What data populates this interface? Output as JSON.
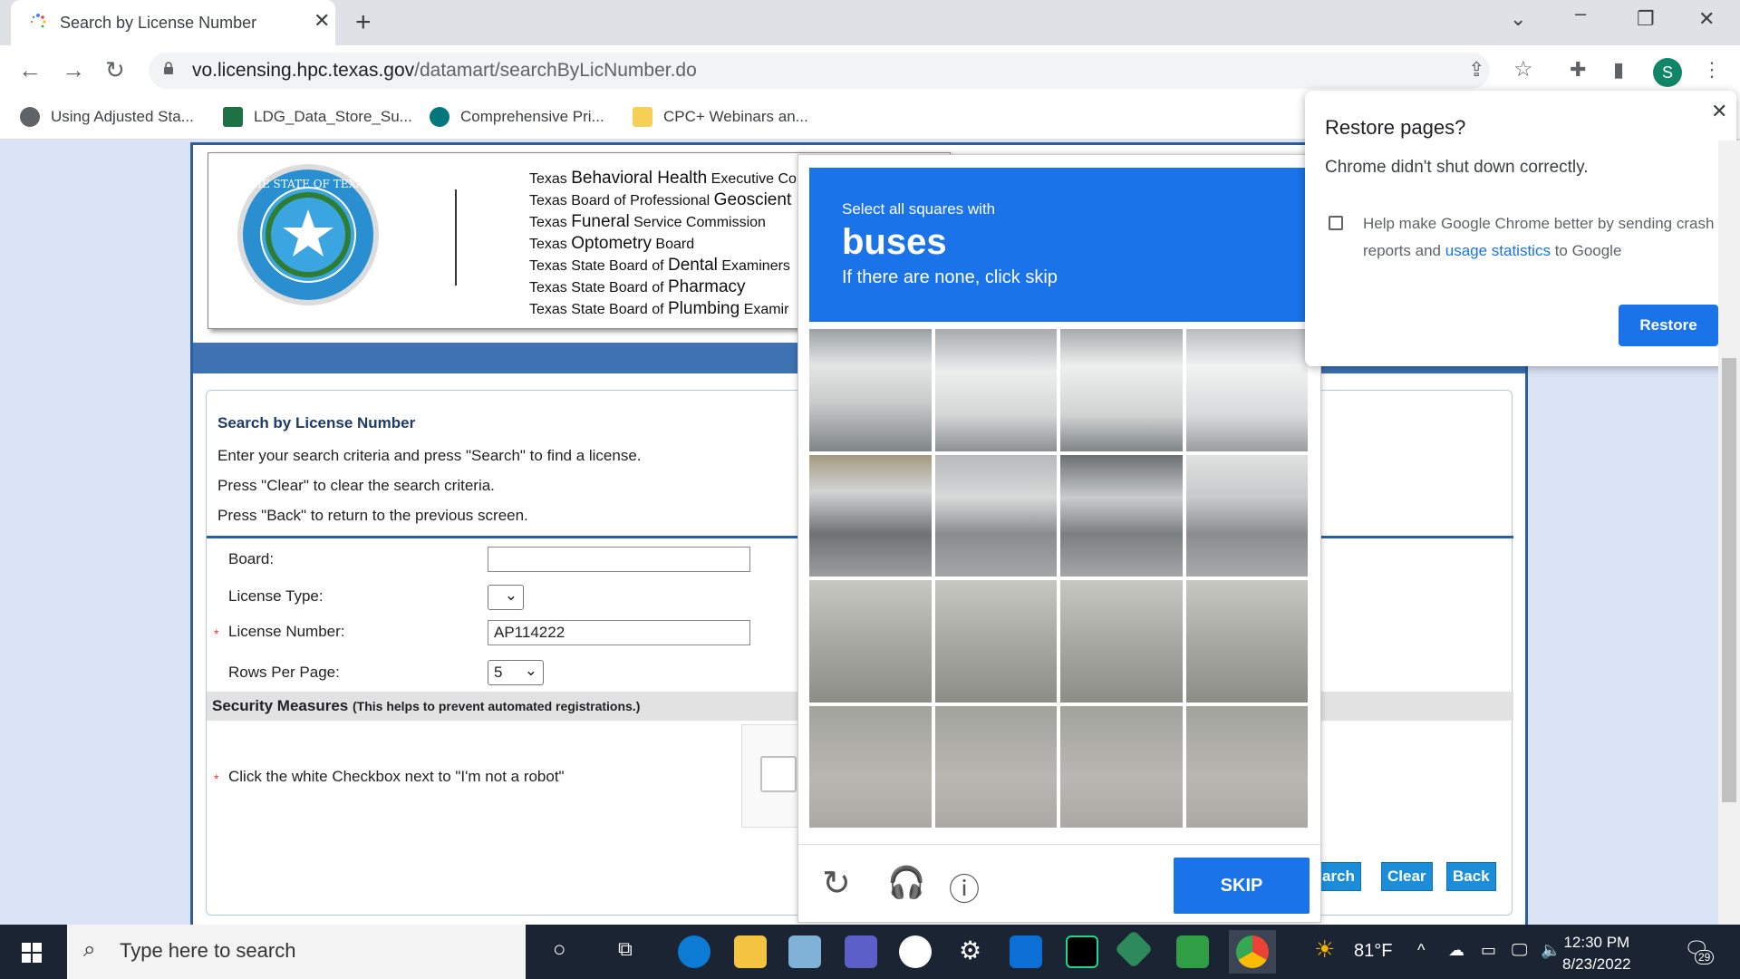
{
  "browser": {
    "tab_title": "Search by License Number",
    "tab_close": "✕",
    "new_tab": "+",
    "url_domain": "vo.licensing.hpc.texas.gov",
    "url_path": "/datamart/searchByLicNumber.do",
    "avatar_letter": "S",
    "bookmarks": [
      "Using Adjusted Sta...",
      "LDG_Data_Store_Su...",
      "Comprehensive Pri...",
      "CPC+ Webinars an..."
    ]
  },
  "header": {
    "boards": [
      {
        "pre": "Texas ",
        "big": "Behavioral Health",
        "post": " Executive Co"
      },
      {
        "pre": "Texas Board of Professional ",
        "big": "Geoscient",
        "post": ""
      },
      {
        "pre": "Texas ",
        "big": "Funeral",
        "post": " Service Commission"
      },
      {
        "pre": "Texas ",
        "big": "Optometry",
        "post": " Board"
      },
      {
        "pre": "Texas State Board of ",
        "big": "Dental",
        "post": " Examiners"
      },
      {
        "pre": "Texas State Board of ",
        "big": "Pharmacy",
        "post": ""
      },
      {
        "pre": "Texas State Board of ",
        "big": "Plumbing",
        "post": " Examir"
      }
    ],
    "seal_text": "THE STATE OF TEXAS"
  },
  "form": {
    "title": "Search by License Number",
    "line1": "Enter your search criteria and press \"Search\" to find a license.",
    "line2": "Press \"Clear\" to clear the search criteria.",
    "line3": "Press \"Back\" to return to the previous screen.",
    "board_label": "Board:",
    "board_value": "",
    "license_type_label": "License Type:",
    "license_type_value": "",
    "license_number_label": "License Number:",
    "license_number_value": "AP114222",
    "rows_label": "Rows Per Page:",
    "rows_value": "5",
    "required_mark": "*",
    "security_title": "Security Measures",
    "security_sub": "(This helps to prevent automated registrations.)",
    "robot_instruction": "Click the white Checkbox next to \"I'm not a robot\"",
    "search_button": "arch",
    "clear_button": "Clear",
    "back_button": "Back"
  },
  "captcha": {
    "line1": "Select all squares with",
    "keyword": "buses",
    "line3": "If there are none, click skip",
    "skip_label": "SKIP",
    "tiles": 16
  },
  "restore_dialog": {
    "heading": "Restore pages?",
    "message": "Chrome didn't shut down correctly.",
    "checkbox_text_1": "Help make Google Chrome better by sending crash reports and ",
    "checkbox_link": "usage statistics",
    "checkbox_text_2": " to Google",
    "button": "Restore",
    "close": "✕"
  },
  "taskbar": {
    "search_placeholder": "Type here to search",
    "weather": "81°F",
    "time": "12:30 PM",
    "date": "8/23/2022",
    "notifications": "29"
  },
  "colors": {
    "accent": "#1a73e8",
    "page_blue": "#2d5ea0",
    "taskbar": "#1b2432"
  }
}
